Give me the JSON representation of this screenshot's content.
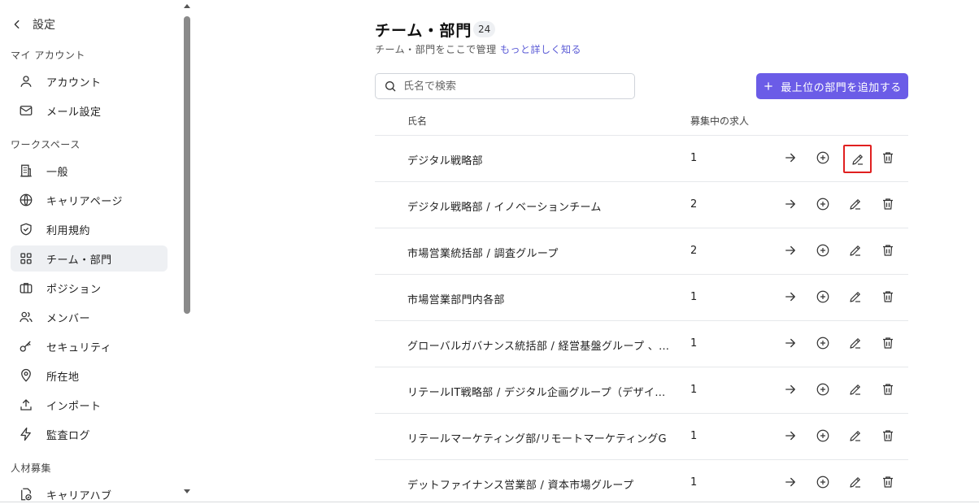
{
  "sidebar": {
    "back_label": "設定",
    "section_account": "マイ アカウント",
    "section_workspace": "ワークスペース",
    "section_recruit": "人材募集",
    "items": [
      {
        "label": "アカウント",
        "icon": "user-icon"
      },
      {
        "label": "メール設定",
        "icon": "mail-icon"
      },
      {
        "label": "一般",
        "icon": "building-icon"
      },
      {
        "label": "キャリアページ",
        "icon": "globe-icon"
      },
      {
        "label": "利用規約",
        "icon": "shield-icon"
      },
      {
        "label": "チーム・部門",
        "icon": "grid-icon",
        "active": true
      },
      {
        "label": "ポジション",
        "icon": "briefcase-icon"
      },
      {
        "label": "メンバー",
        "icon": "users-icon"
      },
      {
        "label": "セキュリティ",
        "icon": "key-icon"
      },
      {
        "label": "所在地",
        "icon": "map-pin-icon"
      },
      {
        "label": "インポート",
        "icon": "upload-icon"
      },
      {
        "label": "監査ログ",
        "icon": "bolt-icon"
      },
      {
        "label": "キャリアハブ",
        "icon": "hub-icon"
      }
    ]
  },
  "header": {
    "title": "チーム・部門",
    "count": "24",
    "subtitle": "チーム・部門をここで管理",
    "learn_more": "もっと詳しく知る"
  },
  "search": {
    "placeholder": "氏名で検索"
  },
  "add_button": {
    "label": "最上位の部門を追加する",
    "color": "#6b5ce7"
  },
  "table": {
    "columns": [
      "氏名",
      "募集中の求人"
    ],
    "rows": [
      {
        "name": "デジタル戦略部",
        "open_jobs": "1"
      },
      {
        "name": "デジタル戦略部 / イノベーションチーム",
        "open_jobs": "2"
      },
      {
        "name": "市場営業統括部 / 調査グループ",
        "open_jobs": "2"
      },
      {
        "name": "市場営業部門内各部",
        "open_jobs": "1"
      },
      {
        "name": "グローバルガバナンス統括部 / 経営基盤グループ 、シ…",
        "open_jobs": "1"
      },
      {
        "name": "リテールIT戦略部 / デジタル企画グループ（デザイン…",
        "open_jobs": "1"
      },
      {
        "name": "リテールマーケティング部/リモートマーケティングG",
        "open_jobs": "1"
      },
      {
        "name": "デットファイナンス営業部 / 資本市場グループ",
        "open_jobs": "1"
      }
    ]
  },
  "highlight_color": "#e02020"
}
